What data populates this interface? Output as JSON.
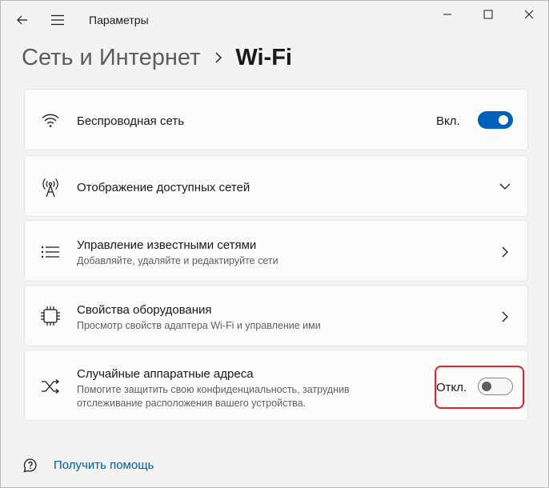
{
  "window": {
    "app_title": "Параметры"
  },
  "breadcrumb": {
    "parent": "Сеть и Интернет",
    "current": "Wi-Fi"
  },
  "cards": {
    "wireless": {
      "title": "Беспроводная сеть",
      "toggle_label": "Вкл.",
      "toggle_on": true,
      "icon": "wifi-icon"
    },
    "available": {
      "title": "Отображение доступных сетей",
      "icon": "antenna-icon",
      "chevron": "chevron-down-icon"
    },
    "known": {
      "title": "Управление известными сетями",
      "subtitle": "Добавляйте, удаляйте и редактируйте сети",
      "icon": "list-icon",
      "chevron": "chevron-right-icon"
    },
    "hardware": {
      "title": "Свойства оборудования",
      "subtitle": "Просмотр свойств адаптера Wi-Fi и управление ими",
      "icon": "chip-icon",
      "chevron": "chevron-right-icon"
    },
    "random_mac": {
      "title": "Случайные аппаратные адреса",
      "subtitle_line1": "Помогите защитить свою конфиденциальность, затруднив",
      "subtitle_line2": "отслеживание расположения вашего устройства.",
      "toggle_label": "Откл.",
      "toggle_on": false,
      "icon": "shuffle-icon"
    }
  },
  "help": {
    "label": "Получить помощь",
    "icon": "help-icon"
  },
  "colors": {
    "accent": "#005fb8",
    "highlight": "#e0232e",
    "link": "#005a9e"
  }
}
